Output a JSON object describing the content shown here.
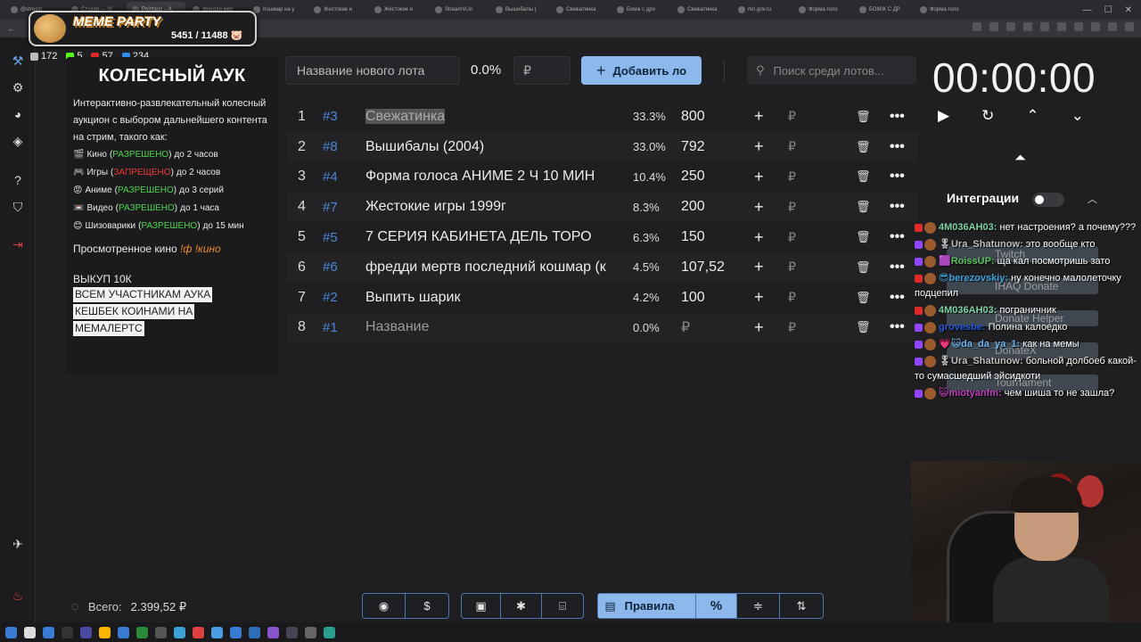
{
  "browser": {
    "tabs": [
      "@stream",
      "Студия — Vi",
      "Pointauc – A",
      "фредди мер",
      "Кошмар на у",
      "Жестокие и",
      "Жестокие и",
      "StreamVi.io",
      "Вышибалы (",
      "Свежатинка",
      "Бомж с дро",
      "Свежатинка",
      "rkn.gov.ru",
      "Форма голо",
      "БОМЖ С ДР",
      "Форма голо"
    ],
    "active_tab_index": 2
  },
  "overlay_badge": {
    "title": "MEME PARTY",
    "count": "5451 / 11488 🐷"
  },
  "stats": [
    {
      "icon": "people-icon",
      "value": "172",
      "color": "#bbbbbb"
    },
    {
      "icon": "kick-icon",
      "value": "5",
      "color": "#53fc18"
    },
    {
      "icon": "vk-live-icon",
      "value": "57",
      "color": "#e02a2a"
    },
    {
      "icon": "viewer-icon",
      "value": "234",
      "color": "#2e8dea"
    }
  ],
  "left_panel": {
    "title": "КОЛЕСНЫЙ АУК",
    "description": "Интерактивно-развлекательный колесный аукцион с выбором дальнейшего контента на стрим, такого как:",
    "categories": [
      {
        "icon": "🎬",
        "name": "Кино",
        "status": "РАЗРЕШЕНО",
        "status_color": "green",
        "limit": "до 2 часов"
      },
      {
        "icon": "🎮",
        "name": "Игры",
        "status": "ЗАПРЕЩЕНО",
        "status_color": "red",
        "limit": "до 2 часов"
      },
      {
        "icon": "😡",
        "name": "Аниме",
        "status": "РАЗРЕШЕНО",
        "status_color": "green",
        "limit": "до 3 серий"
      },
      {
        "icon": "📼",
        "name": "Видео",
        "status": "РАЗРЕШЕНО",
        "status_color": "green",
        "limit": "до 1 часа"
      },
      {
        "icon": "😊",
        "name": "Шизоварики",
        "status": "РАЗРЕШЕНО",
        "status_color": "green",
        "limit": "до 15 мин"
      }
    ],
    "watched_label": "Просмотренное кино",
    "watched_cmd": "!ф !кино",
    "buyout": "ВЫКУП 10К",
    "cashback_lines": [
      "ВСЕМ УЧАСТНИКАМ АУКА",
      "КЕШБЕК КОИНАМИ НА",
      "МЕМАЛЕРТС"
    ]
  },
  "new_lot": {
    "placeholder": "Название нового лота",
    "percent": "0.0%",
    "currency_placeholder": "₽",
    "add_label": "Добавить ло"
  },
  "search": {
    "placeholder": "Поиск среди лотов..."
  },
  "lots": [
    {
      "no": "1",
      "id": "#3",
      "name": "Свежатинка",
      "pct": "33.3%",
      "amount": "800",
      "selected": true
    },
    {
      "no": "2",
      "id": "#8",
      "name": "Вышибалы (2004)",
      "pct": "33.0%",
      "amount": "792"
    },
    {
      "no": "3",
      "id": "#4",
      "name": "Форма голоса АНИМЕ 2 Ч 10 МИН",
      "pct": "10.4%",
      "amount": "250"
    },
    {
      "no": "4",
      "id": "#7",
      "name": "Жестокие игры 1999г",
      "pct": "8.3%",
      "amount": "200"
    },
    {
      "no": "5",
      "id": "#5",
      "name": "7 СЕРИЯ КАБИНЕТА ДЕЛЬ ТОРО",
      "pct": "6.3%",
      "amount": "150"
    },
    {
      "no": "6",
      "id": "#6",
      "name": "фредди мертв последний кошмар (к",
      "pct": "4.5%",
      "amount": "107,52"
    },
    {
      "no": "7",
      "id": "#2",
      "name": "Выпить шарик",
      "pct": "4.2%",
      "amount": "100"
    },
    {
      "no": "8",
      "id": "#1",
      "name": "Название",
      "pct": "0.0%",
      "amount": "₽",
      "placeholder": true
    }
  ],
  "lot_row_symbols": {
    "plus": "+",
    "rub": "₽",
    "trash": "🗑",
    "more": "•••"
  },
  "timer": {
    "value": "00:00:00"
  },
  "integrations": {
    "label": "Интеграции"
  },
  "integration_overlays": [
    "Twitch",
    "IHAQ Donate",
    "Donate Helper",
    "DonateX",
    "Tournament"
  ],
  "chat": [
    {
      "platform": "vk",
      "nick": "4М036АН03:",
      "nick_color": "#7fd3a3",
      "text": " нет настроения? а почему???"
    },
    {
      "platform": "twitch",
      "nick": "🎖Ura_Shatunow:",
      "nick_color": "#c0c0c0",
      "text": " это вообще кто"
    },
    {
      "platform": "twitch",
      "nick": "🟪RoissUP:",
      "nick_color": "#56c05a",
      "text": " ща кал посмотришь зато"
    },
    {
      "platform": "vk",
      "nick": "😎berezovskiy:",
      "nick_color": "#3fa3e0",
      "text": " ну конечно малолеточку подцепил"
    },
    {
      "platform": "vk",
      "nick": "4М036АН03:",
      "nick_color": "#7fd3a3",
      "text": " пограничник"
    },
    {
      "platform": "twitch",
      "nick": "grovesbe:",
      "nick_color": "#2a5ad8",
      "text": " Полина калоедко"
    },
    {
      "platform": "twitch",
      "nick": "💗😺da_da_ya_1:",
      "nick_color": "#6fb4f0",
      "text": " как на мемы"
    },
    {
      "platform": "twitch",
      "nick": "🎖Ura_Shatunow:",
      "nick_color": "#c0c0c0",
      "text": " больной долбоеб какой-то сумасшедший эйсидкоти"
    },
    {
      "platform": "twitch",
      "nick": "😺miotyanfm:",
      "nick_color": "#c03fc0",
      "text": " чем шиша то не зашла?"
    }
  ],
  "footer": {
    "total_label": "Всего:",
    "total_value": "2.399,52 ₽",
    "rules_label": "Правила",
    "percent_symbol": "%"
  },
  "colors": {
    "accent": "#8db8ec",
    "lot_id": "#4a87d8",
    "allowed": "#4ed54e",
    "forbidden": "#ee3b3b"
  }
}
